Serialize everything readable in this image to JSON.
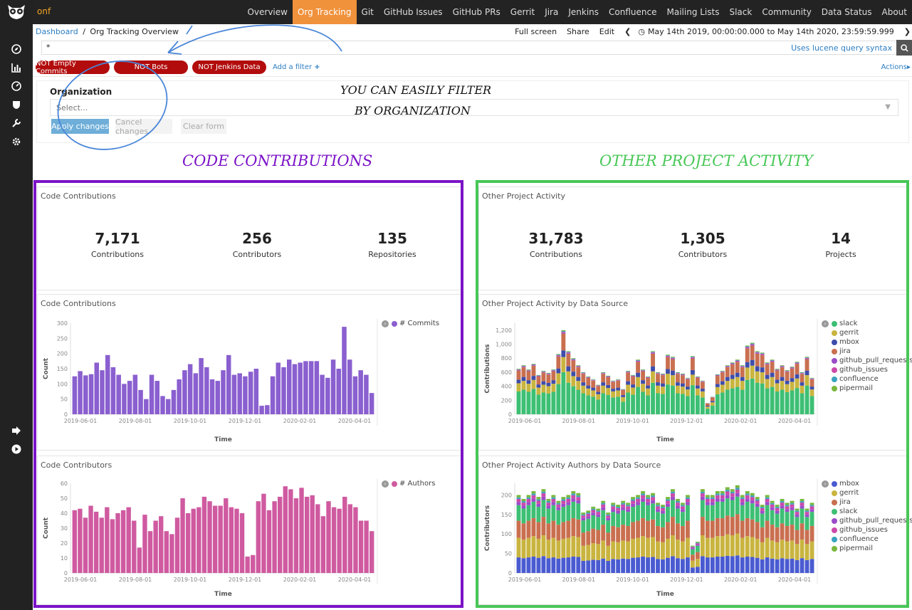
{
  "nav": {
    "brand": "onf",
    "links": [
      "Overview",
      "Org Tracking",
      "Git",
      "GitHub Issues",
      "GitHub PRs",
      "Gerrit",
      "Jira",
      "Jenkins",
      "Confluence",
      "Mailing Lists",
      "Slack",
      "Community",
      "Data Status",
      "About"
    ],
    "active": "Org Tracking"
  },
  "breadcrumb": {
    "root": "Dashboard",
    "separator": "/",
    "current": "Org Tracking Overview"
  },
  "header_actions": {
    "fullscreen": "Full screen",
    "share": "Share",
    "edit": "Edit",
    "time_range": "May 14th 2019, 00:00:00.000 to May 14th 2020, 23:59:59.999"
  },
  "search": {
    "value": "*",
    "lucene": "Uses lucene query syntax"
  },
  "filters": {
    "pills": [
      "NOT Empty Commits",
      "NOT Bots",
      "NOT Jenkins Data"
    ],
    "add_filter": "Add a filter",
    "actions": "Actions"
  },
  "org_panel": {
    "title": "Organization",
    "placeholder": "Select...",
    "apply": "Apply changes",
    "cancel": "Cancel changes",
    "clear": "Clear form"
  },
  "annotations": {
    "filter_note_1": "YOU CAN EASILY FILTER",
    "filter_note_2": "BY ORGANIZATION",
    "left_heading": "CODE CONTRIBUTIONS",
    "right_heading": "OTHER PROJECT ACTIVITY",
    "left_box_color": "#7b13c7",
    "right_box_color": "#48c757"
  },
  "code_metrics": {
    "title": "Code Contributions",
    "items": [
      {
        "value": "7,171",
        "label": "Contributions"
      },
      {
        "value": "256",
        "label": "Contributors"
      },
      {
        "value": "135",
        "label": "Repositories"
      }
    ]
  },
  "other_metrics": {
    "title": "Other Project Activity",
    "items": [
      {
        "value": "31,783",
        "label": "Contributions"
      },
      {
        "value": "1,305",
        "label": "Contributors"
      },
      {
        "value": "14",
        "label": "Projects"
      }
    ]
  },
  "chart_data": [
    {
      "id": "code_commits",
      "type": "bar",
      "title": "Code Contributions",
      "xlabel": "Time",
      "ylabel": "Count",
      "ylim": [
        0,
        300
      ],
      "yticks": [
        0,
        50,
        100,
        150,
        200,
        250,
        300
      ],
      "xticks": [
        "2019-06-01",
        "2019-08-01",
        "2019-10-01",
        "2019-12-01",
        "2020-02-01",
        "2020-04-01"
      ],
      "series": [
        {
          "name": "# Commits",
          "color": "#8a5fcf",
          "values": [
            125,
            142,
            128,
            132,
            170,
            145,
            195,
            155,
            130,
            100,
            110,
            130,
            80,
            50,
            130,
            110,
            60,
            50,
            80,
            115,
            145,
            165,
            135,
            185,
            155,
            115,
            110,
            145,
            195,
            130,
            135,
            125,
            140,
            150,
            28,
            30,
            125,
            170,
            155,
            180,
            165,
            170,
            175,
            175,
            175,
            130,
            120,
            180,
            150,
            288,
            180,
            125,
            145,
            130,
            70
          ]
        }
      ]
    },
    {
      "id": "code_authors",
      "type": "bar",
      "title": "Code Contributors",
      "xlabel": "Time",
      "ylabel": "Count",
      "ylim": [
        0,
        60
      ],
      "yticks": [
        0,
        10,
        20,
        30,
        40,
        50,
        60
      ],
      "xticks": [
        "2019-06-01",
        "2019-08-01",
        "2019-10-01",
        "2019-12-01",
        "2020-02-01",
        "2020-04-01"
      ],
      "series": [
        {
          "name": "# Authors",
          "color": "#cf5aa0",
          "values": [
            42,
            43,
            37,
            45,
            41,
            37,
            44,
            36,
            40,
            42,
            44,
            35,
            17,
            39,
            28,
            35,
            38,
            28,
            26,
            37,
            50,
            40,
            43,
            44,
            51,
            48,
            45,
            45,
            50,
            44,
            43,
            40,
            11,
            12,
            48,
            53,
            42,
            48,
            51,
            58,
            56,
            50,
            57,
            51,
            52,
            46,
            38,
            48,
            44,
            43,
            51,
            46,
            44,
            35,
            35,
            28
          ]
        }
      ]
    },
    {
      "id": "other_activity",
      "type": "bar",
      "stacked": true,
      "title": "Other Project Activity by Data Source",
      "xlabel": "Time",
      "ylabel": "Contributions",
      "ylim": [
        0,
        1300
      ],
      "yticks": [
        0,
        200,
        400,
        600,
        800,
        1000,
        1200
      ],
      "ytick_labels": [
        "0",
        "200",
        "400",
        "600",
        "800",
        "1,000",
        "1,200"
      ],
      "xticks": [
        "2019-06-01",
        "2019-08-01",
        "2019-10-01",
        "2019-12-01",
        "2020-02-01",
        "2020-04-01"
      ],
      "totals": [
        650,
        700,
        640,
        720,
        560,
        620,
        590,
        640,
        860,
        1200,
        900,
        800,
        700,
        600,
        540,
        500,
        420,
        600,
        550,
        480,
        500,
        360,
        620,
        560,
        780,
        640,
        540,
        900,
        600,
        580,
        850,
        820,
        600,
        580,
        520,
        830,
        540,
        480,
        160,
        250,
        570,
        620,
        700,
        740,
        780,
        700,
        980,
        1020,
        900,
        880,
        740,
        780,
        650,
        700,
        630,
        680,
        750,
        600,
        820,
        520
      ],
      "series": [
        {
          "name": "slack",
          "color": "#3dbf74",
          "share": 0.5
        },
        {
          "name": "gerrit",
          "color": "#c9b43f",
          "share": 0.18
        },
        {
          "name": "mbox",
          "color": "#3e4dab",
          "share": 0.08
        },
        {
          "name": "jira",
          "color": "#c96f50",
          "share": 0.2
        },
        {
          "name": "github_pull_requests",
          "color": "#9a4cc9",
          "share": 0.01
        },
        {
          "name": "github_issues",
          "color": "#cc48a9",
          "share": 0.01
        },
        {
          "name": "confluence",
          "color": "#3aa2bf",
          "share": 0.01
        },
        {
          "name": "pipermail",
          "color": "#7ab83d",
          "share": 0.01
        }
      ]
    },
    {
      "id": "other_authors",
      "type": "bar",
      "stacked": true,
      "title": "Other Project Activity Authors by Data Source",
      "xlabel": "Time",
      "ylabel": "Contributors",
      "ylim": [
        0,
        230
      ],
      "yticks": [
        0,
        50,
        100,
        150,
        200
      ],
      "xticks": [
        "2019-06-01",
        "2019-08-01",
        "2019-10-01",
        "2019-12-01",
        "2020-02-01",
        "2020-04-01"
      ],
      "totals": [
        200,
        190,
        200,
        210,
        195,
        215,
        190,
        200,
        185,
        195,
        200,
        210,
        205,
        155,
        160,
        170,
        165,
        185,
        155,
        180,
        175,
        185,
        180,
        195,
        200,
        210,
        200,
        205,
        180,
        175,
        195,
        215,
        190,
        180,
        200,
        70,
        80,
        215,
        200,
        200,
        210,
        210,
        220,
        215,
        225,
        200,
        210,
        205,
        195,
        175,
        200,
        185,
        175,
        190,
        180,
        185,
        165,
        190,
        165,
        180
      ],
      "series": [
        {
          "name": "mbox",
          "color": "#4a5bd1",
          "share": 0.2
        },
        {
          "name": "gerrit",
          "color": "#c9b43f",
          "share": 0.25
        },
        {
          "name": "jira",
          "color": "#c96f50",
          "share": 0.22
        },
        {
          "name": "slack",
          "color": "#3dbf74",
          "share": 0.2
        },
        {
          "name": "github_pull_requests",
          "color": "#9a4cc9",
          "share": 0.04
        },
        {
          "name": "github_issues",
          "color": "#cc48a9",
          "share": 0.04
        },
        {
          "name": "confluence",
          "color": "#3aa2bf",
          "share": 0.02
        },
        {
          "name": "pipermail",
          "color": "#7ab83d",
          "share": 0.03
        }
      ]
    }
  ]
}
